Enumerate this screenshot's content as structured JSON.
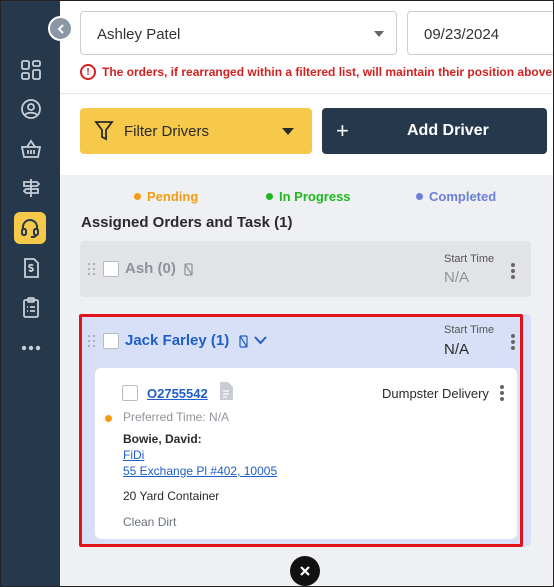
{
  "sidebar": {
    "items": [
      {
        "icon": "dashboard-icon"
      },
      {
        "icon": "user-circle-icon"
      },
      {
        "icon": "basket-icon"
      },
      {
        "icon": "signpost-icon"
      },
      {
        "icon": "headset-icon",
        "active": true
      },
      {
        "icon": "invoice-dollar-icon"
      },
      {
        "icon": "clipboard-icon"
      },
      {
        "icon": "more-dots-icon"
      }
    ],
    "collapse_icon": "chevron-left-icon"
  },
  "header": {
    "driver_select": "Ashley Patel",
    "date_value": "09/23/2024",
    "warning": "The orders, if rearranged within a filtered list, will maintain their position above the o"
  },
  "toolbar": {
    "filter_label": "Filter Drivers",
    "add_label": "Add Driver"
  },
  "legend": {
    "pending": "Pending",
    "in_progress": "In Progress",
    "completed": "Completed"
  },
  "section_title": "Assigned Orders and Task (1)",
  "drivers": [
    {
      "name": "Ash (0)",
      "start_label": "Start Time",
      "start_value": "N/A"
    },
    {
      "name": "Jack Farley (1)",
      "start_label": "Start Time",
      "start_value": "N/A"
    }
  ],
  "order": {
    "id": "O2755542",
    "type": "Dumpster Delivery",
    "preferred_time": "Preferred Time: N/A",
    "customer": "Bowie, David:",
    "location": "FiDi",
    "address": "55 Exchange Pl #402, 10005",
    "container": "20 Yard Container",
    "material": "Clean Dirt"
  },
  "colors": {
    "sidebar": "#26384c",
    "accent_yellow": "#f7c94b",
    "pending": "#f39c12",
    "in_progress": "#1fb81f",
    "completed": "#6b7fd7",
    "link_blue": "#1f5ec9",
    "warning_red": "#d62020"
  }
}
